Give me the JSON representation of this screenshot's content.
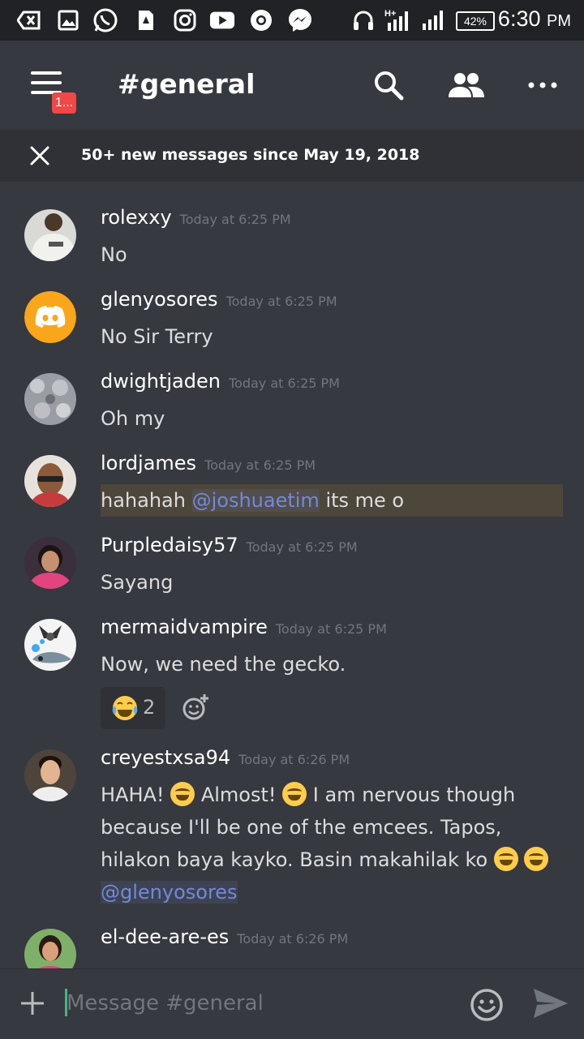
{
  "status_bar": {
    "network": "H+",
    "battery": "42%",
    "time": "6:30",
    "ampm": "PM"
  },
  "header": {
    "badge": "1...",
    "channel": "#general"
  },
  "banner": {
    "text": "50+ new messages since May 19, 2018"
  },
  "messages": [
    {
      "user": "rolexxy",
      "time": "Today at 6:25 PM",
      "text": "No"
    },
    {
      "user": "glenyosores",
      "time": "Today at 6:25 PM",
      "text": "No Sir Terry"
    },
    {
      "user": "dwightjaden",
      "time": "Today at 6:25 PM",
      "text": "Oh my"
    },
    {
      "user": "lordjames",
      "time": "Today at 6:25 PM",
      "text_before": "hahahah ",
      "mention": "@joshuaetim",
      "text_after": " its me o"
    },
    {
      "user": "Purpledaisy57",
      "time": "Today at 6:25 PM",
      "text": "Sayang"
    },
    {
      "user": "mermaidvampire",
      "time": "Today at 6:25 PM",
      "text": "Now, we need the gecko.",
      "reaction_count": "2"
    },
    {
      "user": "creyestxsa94",
      "time": "Today at 6:26 PM",
      "text_1": "HAHA! ",
      "text_2": " Almost! ",
      "text_3": " I am nervous though because I'll be one of the emcees. Tapos, hilakon baya kayko. Basin makahilak ko ",
      "mention": "@glenyosores"
    },
    {
      "user": "el-dee-are-es",
      "time": "Today at 6:26 PM"
    }
  ],
  "composer": {
    "placeholder": "Message #general"
  },
  "colors": {
    "background": "#36393f",
    "mention": "#7289da",
    "badge": "#f04747",
    "cursor": "#43b581"
  }
}
